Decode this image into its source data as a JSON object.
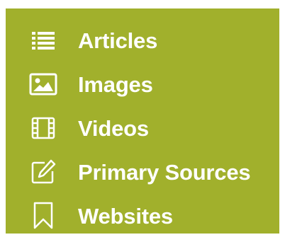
{
  "colors": {
    "panel_background": "#a1b02c",
    "foreground": "#ffffff"
  },
  "menu": {
    "items": [
      {
        "label": "Articles",
        "icon": "list-icon"
      },
      {
        "label": "Images",
        "icon": "image-icon"
      },
      {
        "label": "Videos",
        "icon": "film-icon"
      },
      {
        "label": "Primary Sources",
        "icon": "edit-document-icon"
      },
      {
        "label": "Websites",
        "icon": "bookmark-icon"
      }
    ]
  }
}
